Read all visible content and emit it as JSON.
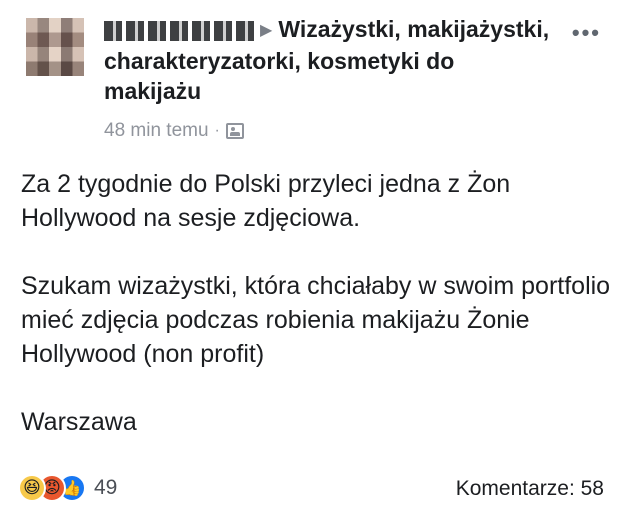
{
  "post": {
    "author_redacted": "P... ...",
    "group_title": "Wizażystki, makijażystki, charakteryzatorki, kosmetyki do makijażu",
    "time": "48 min temu",
    "separator": "·",
    "more_icon": "•••",
    "body": [
      "Za 2 tygodnie do Polski przyleci jedna z Żon Hollywood na sesje zdjęciowa.",
      "Szukam wizażystki, która chciałaby w swoim portfolio mieć zdjęcia podczas robienia makijażu Żonie Hollywood (non profit)",
      "Warszawa"
    ]
  },
  "footer": {
    "reaction_icons": [
      "haha-icon",
      "angry-icon",
      "like-icon"
    ],
    "reaction_count": "49",
    "comments_label": "Komentarze: 58"
  }
}
